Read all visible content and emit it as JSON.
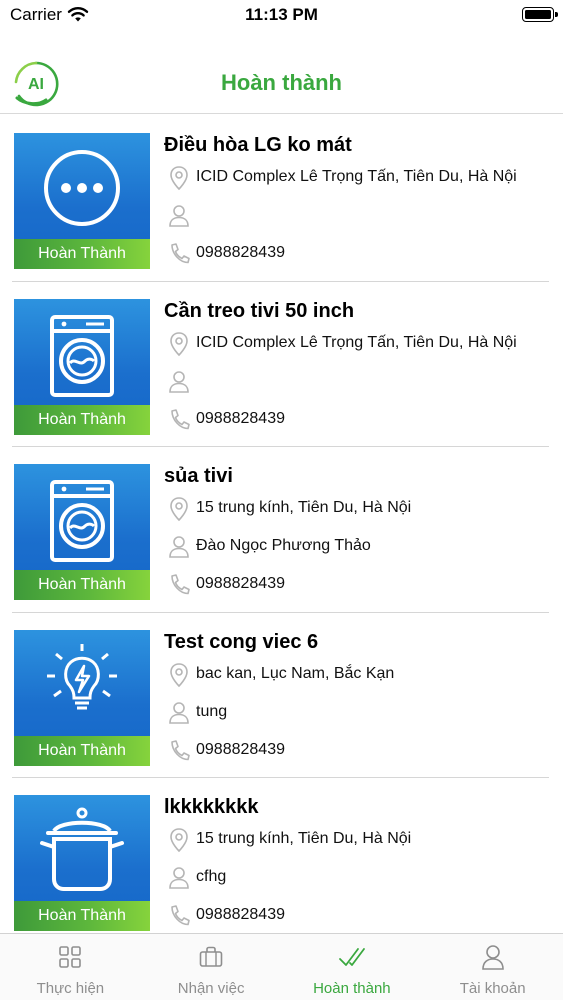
{
  "status_bar": {
    "carrier": "Carrier",
    "time": "11:13 PM"
  },
  "header": {
    "logo_text": "AI",
    "title": "Hoàn thành"
  },
  "colors": {
    "accent": "#3aa83f",
    "thumb_blue": "#1b6fcd",
    "status_green": "#5db73c",
    "tab_inactive": "#8e8e8e"
  },
  "jobs": [
    {
      "icon": "chat-bubble-icon",
      "status": "Hoàn Thành",
      "title": "Điều hòa LG ko mát",
      "address": "ICID Complex Lê Trọng Tấn, Tiên Du, Hà Nội",
      "person": "",
      "phone": "0988828439"
    },
    {
      "icon": "washing-machine-icon",
      "status": "Hoàn Thành",
      "title": "Cần treo tivi 50 inch",
      "address": "ICID Complex Lê Trọng Tấn, Tiên Du, Hà Nội",
      "person": "",
      "phone": "0988828439"
    },
    {
      "icon": "washing-machine-icon",
      "status": "Hoàn Thành",
      "title": "sủa tivi",
      "address": "15 trung kính, Tiên Du, Hà Nội",
      "person": "Đào Ngọc Phương Thảo",
      "phone": "0988828439"
    },
    {
      "icon": "light-bulb-icon",
      "status": "Hoàn Thành",
      "title": "Test cong viec 6",
      "address": "bac kan, Lục Nam, Bắc Kạn",
      "person": "tung",
      "phone": "0988828439"
    },
    {
      "icon": "cooking-pot-icon",
      "status": "Hoàn Thành",
      "title": "lkkkkkkkk",
      "address": "15 trung kính, Tiên Du, Hà Nội",
      "person": "cfhg",
      "phone": "0988828439"
    }
  ],
  "tabs": [
    {
      "label": "Thực hiện",
      "icon": "grid-icon",
      "active": false
    },
    {
      "label": "Nhận việc",
      "icon": "briefcase-icon",
      "active": false
    },
    {
      "label": "Hoàn thành",
      "icon": "double-check-icon",
      "active": true
    },
    {
      "label": "Tài khoản",
      "icon": "user-icon",
      "active": false
    }
  ]
}
